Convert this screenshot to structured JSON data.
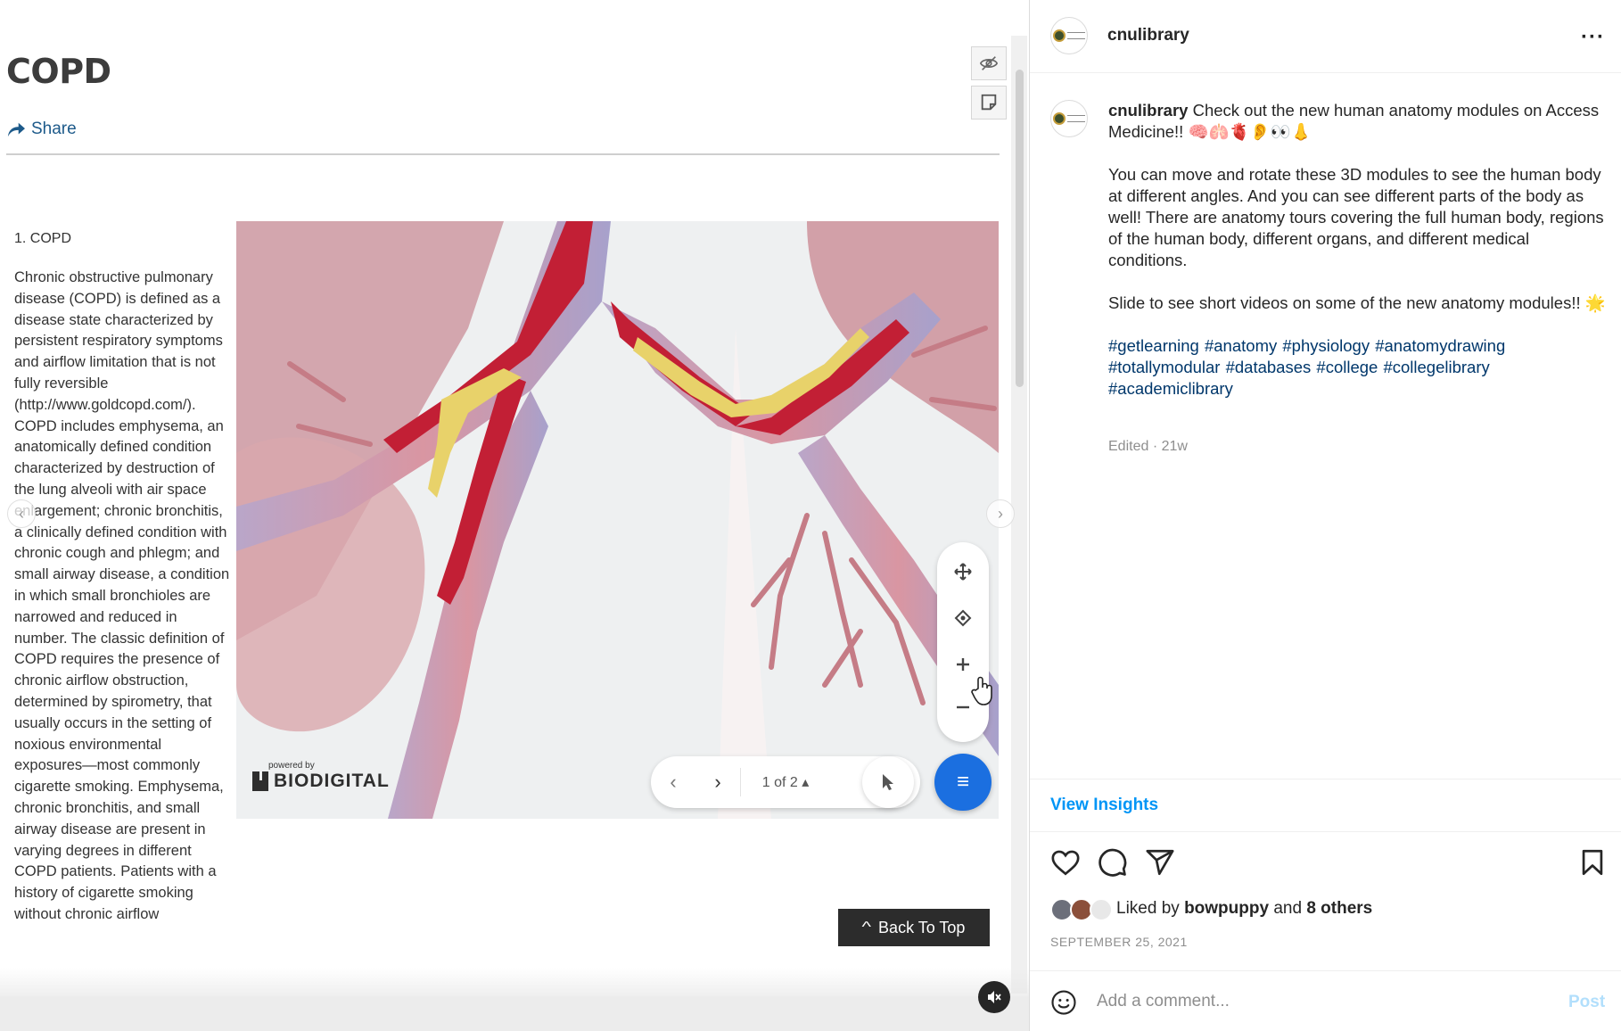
{
  "slide": {
    "title": "COPD",
    "share_label": "Share",
    "section_heading": "1. COPD",
    "body": "Chronic obstructive pulmonary disease (COPD) is defined as a disease state characterized by persistent respiratory symptoms and airflow limitation that is not fully reversible (http://www.goldcopd.com/). COPD includes emphysema, an anatomically defined condition characterized by destruction of the lung alveoli with air space enlargement; chronic bronchitis, a clinically defined condition with chronic cough and phlegm; and small airway disease, a condition in which small bronchioles are narrowed and reduced in number. The classic definition of COPD requires the presence of chronic airflow obstruction, determined by spirometry, that usually occurs in the setting of noxious environmental exposures—most commonly cigarette smoking. Emphysema, chronic bronchitis, and small airway disease are present in varying degrees in different COPD patients. Patients with a history of cigarette smoking without chronic airflow",
    "viewer": {
      "powered_by": "powered by",
      "brand": "BIODIGITAL",
      "page_counter": "1 of 2"
    },
    "back_to_top": "Back To Top"
  },
  "post": {
    "username": "cnulibrary",
    "caption_intro": "Check out the new human anatomy modules on Access Medicine!! 🧠🫁🫀👂👀👃",
    "caption_p2": "You can move and rotate these 3D modules to see the human body at different angles. And you can see different parts of the body as well! There are anatomy tours covering the full human body, regions of the human body, different organs, and different medical conditions.",
    "caption_p3": "Slide to see short videos on some of the new anatomy modules!! 🌟",
    "hashtags": [
      "#getlearning",
      "#anatomy",
      "#physiology",
      "#anatomydrawing",
      "#totallymodular",
      "#databases",
      "#college",
      "#collegelibrary",
      "#academiclibrary"
    ],
    "edited": "Edited · 21w",
    "view_insights": "View Insights",
    "liked_by_prefix": "Liked by",
    "liked_by_user": "bowpuppy",
    "liked_by_and": "and",
    "liked_by_others": "8 others",
    "date": "SEPTEMBER 25, 2021",
    "comment_placeholder": "Add a comment...",
    "post_button": "Post"
  },
  "colors": {
    "link_blue": "#00376b",
    "insights_blue": "#0095f6",
    "post_disabled": "#b2dffc",
    "viewer_menu_blue": "#1b6fe0"
  },
  "icons": [
    "share-icon",
    "hide-icon",
    "note-icon",
    "move-icon",
    "center-icon",
    "zoom-in-icon",
    "zoom-out-icon",
    "prev-icon",
    "next-icon",
    "pointer-icon",
    "menu-icon",
    "mute-icon",
    "more-icon",
    "heart-icon",
    "comment-icon",
    "send-icon",
    "bookmark-icon",
    "emoji-icon"
  ]
}
